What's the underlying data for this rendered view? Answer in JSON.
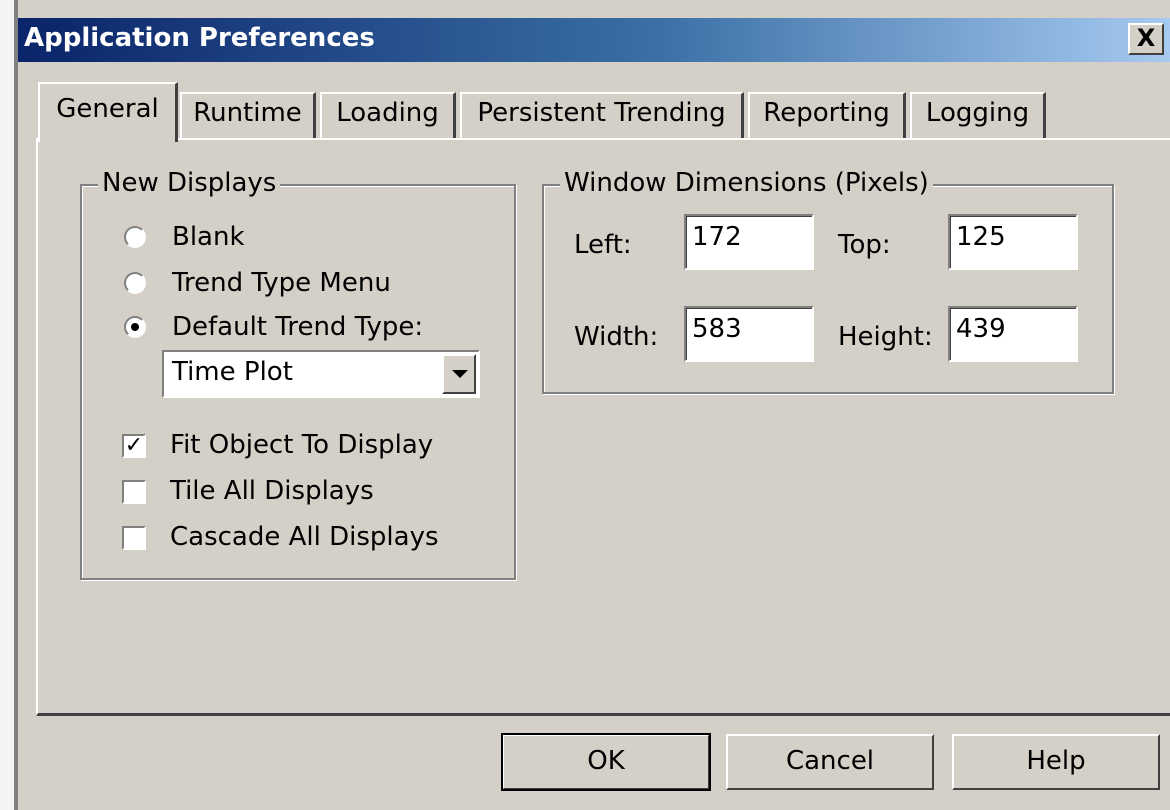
{
  "window": {
    "title": "Application Preferences",
    "close_glyph": "X"
  },
  "tabs": [
    {
      "label": "General",
      "active": true
    },
    {
      "label": "Runtime",
      "active": false
    },
    {
      "label": "Loading",
      "active": false
    },
    {
      "label": "Persistent Trending",
      "active": false
    },
    {
      "label": "Reporting",
      "active": false
    },
    {
      "label": "Logging",
      "active": false
    }
  ],
  "new_displays": {
    "legend": "New Displays",
    "options": [
      {
        "label": "Blank",
        "selected": false
      },
      {
        "label": "Trend Type Menu",
        "selected": false
      },
      {
        "label": "Default Trend Type:",
        "selected": true
      }
    ],
    "trend_type": {
      "value": "Time Plot",
      "icon": "chevron-down-icon"
    },
    "checkboxes": [
      {
        "label": "Fit Object To Display",
        "checked": true
      },
      {
        "label": "Tile All Displays",
        "checked": false
      },
      {
        "label": "Cascade All Displays",
        "checked": false
      }
    ]
  },
  "window_dimensions": {
    "legend": "Window Dimensions (Pixels)",
    "left_label": "Left:",
    "left_value": "172",
    "top_label": "Top:",
    "top_value": "125",
    "width_label": "Width:",
    "width_value": "583",
    "height_label": "Height:",
    "height_value": "439"
  },
  "buttons": {
    "ok": "OK",
    "cancel": "Cancel",
    "help": "Help"
  },
  "colors": {
    "face": "#d4d0c8",
    "title_start": "#0a246a",
    "title_end": "#a6caf0"
  }
}
